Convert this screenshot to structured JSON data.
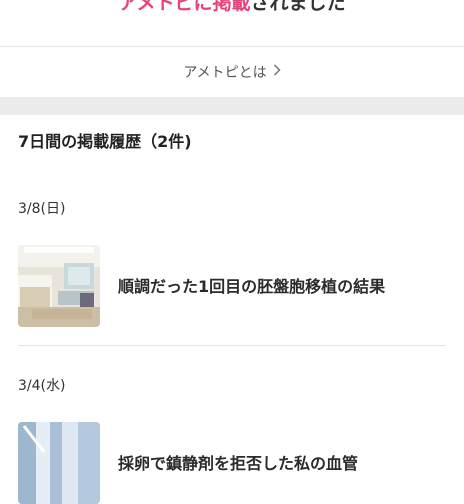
{
  "banner": {
    "title_highlight": "アメトピに掲載",
    "title_rest": "されました"
  },
  "about_link": {
    "label": "アメトピとは",
    "icon": "chevron-right-icon"
  },
  "history": {
    "title": "7日間の掲載履歴（2件)",
    "entries": [
      {
        "date": "3/8(日)",
        "title": "順調だった1回目の胚盤胞移植の結果",
        "thumbnail": "clinic-waiting-room-photo"
      },
      {
        "date": "3/4(水)",
        "title": "採卵で鎮静剤を拒否した私の血管",
        "thumbnail": "hospital-iv-photo"
      }
    ]
  },
  "colors": {
    "accent_pink": "#e8427c",
    "band_gray": "#ececec",
    "text": "#333333"
  }
}
